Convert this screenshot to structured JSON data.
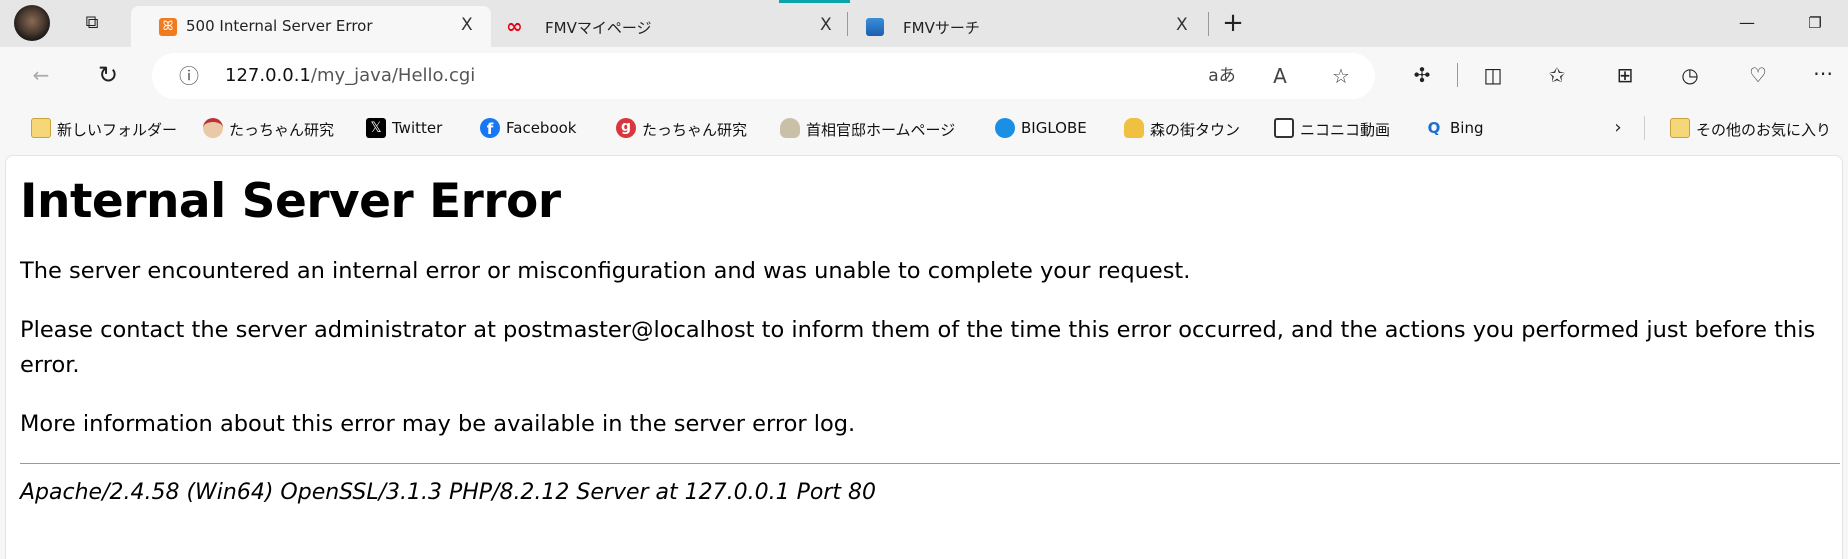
{
  "browser": {
    "tabs": [
      {
        "title": "500 Internal Server Error",
        "icon": "xampp-icon",
        "active": true
      },
      {
        "title": "FMVマイページ",
        "icon": "fujitsu-icon",
        "active": false
      },
      {
        "title": "FMVサーチ",
        "icon": "cloud-icon",
        "active": false
      }
    ],
    "close_glyph": "X",
    "new_tab_glyph": "+",
    "address": {
      "host": "127.0.0.1",
      "path": "/my_java/Hello.cgi"
    },
    "bookmarks": [
      {
        "label": "新しいフォルダー",
        "icon": "folder-icon"
      },
      {
        "label": "たっちゃん研究",
        "icon": "avatar-icon"
      },
      {
        "label": "Twitter",
        "icon": "x-icon"
      },
      {
        "label": "Facebook",
        "icon": "facebook-icon"
      },
      {
        "label": "たっちゃん研究",
        "icon": "g-icon"
      },
      {
        "label": "首相官邸ホームページ",
        "icon": "emblem-icon"
      },
      {
        "label": "BIGLOBE",
        "icon": "biglobe-icon"
      },
      {
        "label": "森の街タウン",
        "icon": "cat-icon"
      },
      {
        "label": "ニコニコ動画",
        "icon": "tv-icon"
      },
      {
        "label": "Bing",
        "icon": "search-icon"
      }
    ],
    "other_favorites": "その他のお気に入り",
    "colors": {
      "accent_teal": "#0aa3a8",
      "xampp_orange": "#f07b1c"
    }
  },
  "page": {
    "heading": "Internal Server Error",
    "paragraphs": [
      "The server encountered an internal error or misconfiguration and was unable to complete your request.",
      "Please contact the server administrator at postmaster@localhost to inform them of the time this error occurred, and the actions you performed just before this error.",
      "More information about this error may be available in the server error log."
    ],
    "footer": "Apache/2.4.58 (Win64) OpenSSL/3.1.3 PHP/8.2.12 Server at 127.0.0.1 Port 80"
  }
}
